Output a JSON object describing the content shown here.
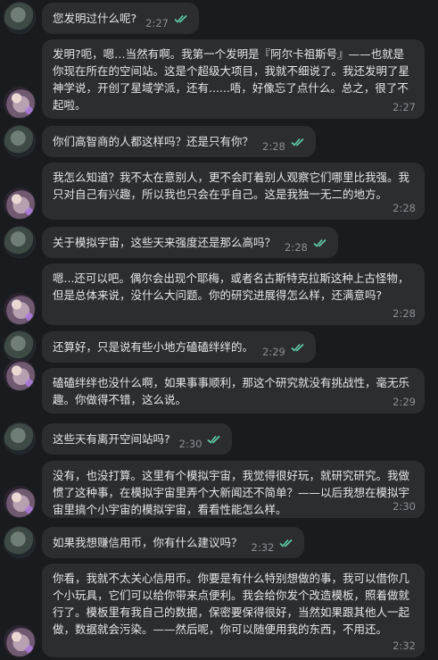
{
  "messages": [
    {
      "sender": "me",
      "text": "您发明过什么呢?",
      "time": "2:27",
      "read": true
    },
    {
      "sender": "her",
      "text": "发明?呃，嗯…当然有啊。我第一个发明是『阿尔卡祖斯号』——也就是你现在所在的空间站。这是个超级大项目，我就不细说了。我还发明了星神学说，开创了星域学派，还有......唔，好像忘了点什么。总之，很了不起啦。",
      "time": "2:27"
    },
    {
      "sender": "me",
      "text": "你们高智商的人都这样吗？还是只有你？",
      "time": "2:28",
      "read": true
    },
    {
      "sender": "her",
      "text": "我怎么知道？我不太在意别人，更不会盯着别人观察它们哪里比我强。我只对自己有兴趣，所以我也只会在乎自己。这是我独一无二的地方。",
      "time": "2:28"
    },
    {
      "sender": "me",
      "text": "关于模拟宇宙，这些天来强度还是那么高吗？",
      "time": "2:28",
      "read": true
    },
    {
      "sender": "her",
      "text": "嗯...还可以吧。偶尔会出现个耶梅，或者名古斯特克拉斯这种上古怪物，但是总体来说，没什么大问题。你的研究进展得怎么样，还满意吗?",
      "time": "2:28"
    },
    {
      "sender": "me",
      "text": "还算好，只是说有些小地方磕磕绊绊的。",
      "time": "2:29",
      "read": true
    },
    {
      "sender": "her",
      "text": "磕磕绊绊也没什么啊，如果事事顺利，那这个研究就没有挑战性，毫无乐趣。你做得不错，这么说。",
      "time": "2:29"
    },
    {
      "sender": "me",
      "text": "这些天有离开空间站吗?",
      "time": "2:30",
      "read": true
    },
    {
      "sender": "her",
      "text": "没有，也没打算。这里有个模拟宇宙，我觉得很好玩，就研究研究。我做惯了这种事，在模拟宇宙里弄个大新闻还不简单？——以后我想在模拟宇宙里搞个小宇宙的模拟宇宙，看看性能怎么样。",
      "time": "2:30"
    },
    {
      "sender": "me",
      "text": "如果我想赚信用币，你有什么建议吗？",
      "time": "2:32",
      "read": true
    },
    {
      "sender": "her",
      "text": "你看，我就不太关心信用币。你要是有什么特别想做的事，我可以借你几个小玩具，它们可以给你带来点便利。我会给你发个改造模板，照着做就行了。模板里有我自己的数据，保密要保得很好，当然如果跟其他人一起做，数据就会污染。——然后呢，你可以随便用我的东西，不用还。",
      "time": "2:32"
    }
  ]
}
